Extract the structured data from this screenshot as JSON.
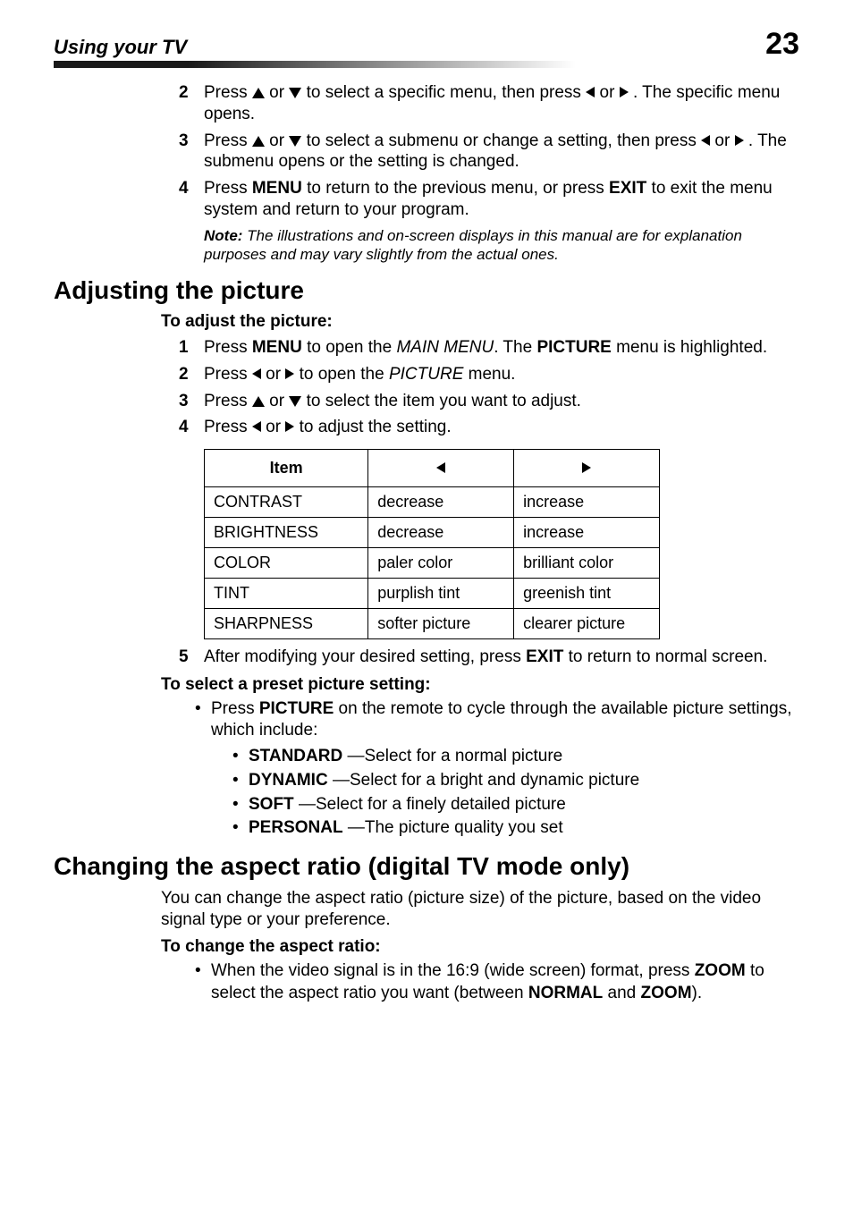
{
  "header": {
    "section": "Using your TV",
    "page": "23"
  },
  "top_steps": [
    {
      "num": "2",
      "pre": "Press ",
      "mid": " or ",
      "post1": " to select a specific menu, then press ",
      "post2": " or ",
      "post3": " . The specific menu opens."
    },
    {
      "num": "3",
      "pre": "Press ",
      "mid": " or ",
      "post1": " to select a submenu or change a setting, then press ",
      "post2": " or ",
      "post3": " . The submenu opens or the setting is changed."
    },
    {
      "num": "4",
      "a": "Press ",
      "b": "MENU",
      "c": " to return to the previous menu, or press ",
      "d": "EXIT",
      "e": " to exit the menu system and return to your program."
    }
  ],
  "note": {
    "label": "Note:",
    "body": " The illustrations and on-screen displays in this manual are for explanation purposes and may vary slightly from the actual ones."
  },
  "adjust": {
    "heading": "Adjusting the picture",
    "proc": "To adjust the picture:",
    "steps": {
      "s1a": "Press ",
      "s1b": "MENU",
      "s1c": " to open the ",
      "s1d": "MAIN MENU",
      "s1e": ". The ",
      "s1f": "PICTURE",
      "s1g": " menu is highlighted.",
      "s2a": "Press ",
      "s2b": " or ",
      "s2c": " to open the ",
      "s2d": "PICTURE",
      "s2e": " menu.",
      "s3a": "Press ",
      "s3b": " or ",
      "s3c": " to select the item you want to adjust.",
      "s4a": "Press ",
      "s4b": " or ",
      "s4c": " to adjust the setting.",
      "s5a": "After modifying your desired setting, press ",
      "s5b": "EXIT",
      "s5c": " to return to normal screen."
    },
    "table": {
      "h1": "Item",
      "r1": {
        "c1": "CONTRAST",
        "c2": "decrease",
        "c3": "increase"
      },
      "r2": {
        "c1": "BRIGHTNESS",
        "c2": "decrease",
        "c3": "increase"
      },
      "r3": {
        "c1": "COLOR",
        "c2": "paler color",
        "c3": "brilliant color"
      },
      "r4": {
        "c1": "TINT",
        "c2": "purplish tint",
        "c3": "greenish tint"
      },
      "r5": {
        "c1": "SHARPNESS",
        "c2": "softer picture",
        "c3": "clearer picture"
      }
    },
    "preset": {
      "proc": "To select a preset picture setting:",
      "intro_a": "Press ",
      "intro_b": "PICTURE",
      "intro_c": " on the remote to cycle through the available picture settings, which include:",
      "i1a": "STANDARD",
      "i1b": " —Select for a normal picture",
      "i2a": "DYNAMIC",
      "i2b": " —Select for a bright and dynamic picture",
      "i3a": "SOFT",
      "i3b": " —Select for a finely detailed picture",
      "i4a": "PERSONAL",
      "i4b": " —The picture quality you set"
    }
  },
  "aspect": {
    "heading": "Changing the aspect ratio (digital TV mode only)",
    "intro": "You can change the aspect ratio (picture size) of the picture, based on the video signal type or your preference.",
    "proc": "To change the aspect ratio:",
    "b_a": "When the video signal is in the 16:9 (wide screen) format, press ",
    "b_b": "ZOOM",
    "b_c": " to select the aspect ratio you want (between ",
    "b_d": "NORMAL",
    "b_e": " and ",
    "b_f": "ZOOM",
    "b_g": ")."
  }
}
